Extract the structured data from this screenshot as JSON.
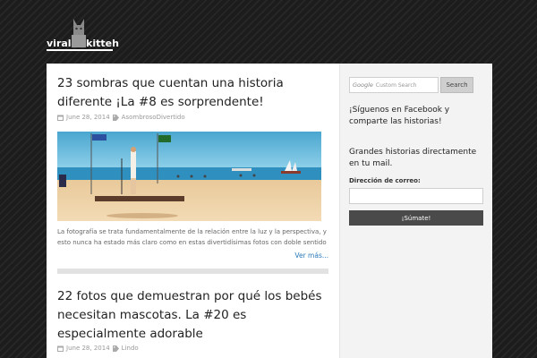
{
  "logo": {
    "word_left": "viral",
    "word_right": "kitteh"
  },
  "posts": [
    {
      "title": "23 sombras que cuentan una historia diferente ¡La #8 es sorprendente!",
      "date": "June 28, 2014",
      "category": "AsombrosoDivertido",
      "excerpt": "La fotografía se trata fundamentalmente de la relación entre la luz y la perspectiva, y esto nunca ha estado más claro como en estas divertidísimas fotos con doble sentido",
      "read_more": "Ver más..."
    },
    {
      "title": "22 fotos que demuestran por qué los bebés necesitan mascotas. La #20 es especialmente adorable",
      "date": "June 28, 2014",
      "category": "Lindo"
    }
  ],
  "sidebar": {
    "search_brand": "Google",
    "search_placeholder": "Custom Search",
    "search_button": "Search",
    "facebook_text": "¡Síguenos en Facebook y comparte las historias!",
    "mail_text": "Grandes historias directamente en tu mail.",
    "email_label": "Dirección de correo:",
    "subscribe_button": "¡Súmate!"
  }
}
